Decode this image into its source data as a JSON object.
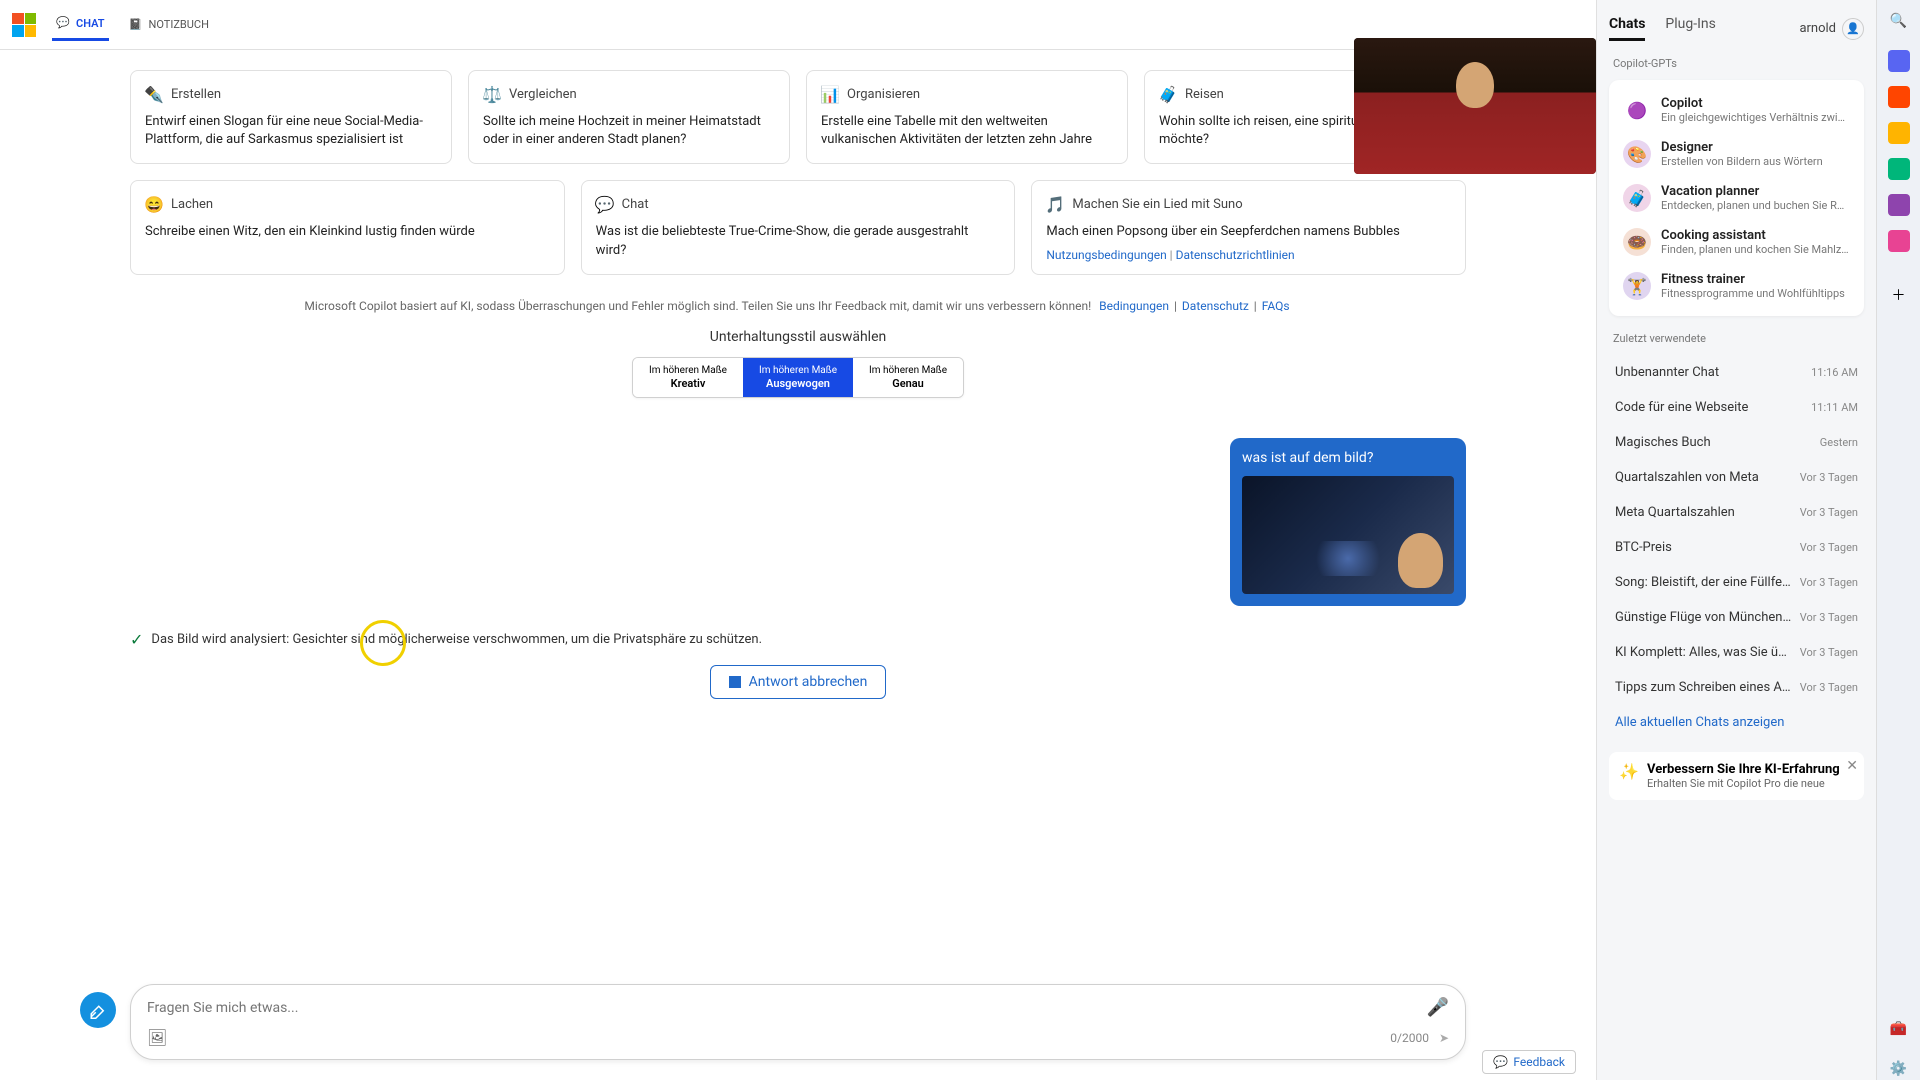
{
  "header": {
    "tab_chat": "CHAT",
    "tab_notebook": "NOTIZBUCH"
  },
  "cards_row1": [
    {
      "icon": "✒️",
      "title": "Erstellen",
      "body": "Entwirf einen Slogan für eine neue Social-Media-Plattform, die auf Sarkasmus spezialisiert ist"
    },
    {
      "icon": "⚖️",
      "title": "Vergleichen",
      "body": "Sollte ich meine Hochzeit in meiner Heimatstadt oder in einer anderen Stadt planen?"
    },
    {
      "icon": "📊",
      "title": "Organisieren",
      "body": "Erstelle eine Tabelle mit den weltweiten vulkanischen Aktivitäten der letzten zehn Jahre"
    },
    {
      "icon": "🧳",
      "title": "Reisen",
      "body": "Wohin sollte ich reisen, eine spirituelle Erfahrung möchte?"
    }
  ],
  "cards_row2": [
    {
      "icon": "😄",
      "title": "Lachen",
      "body": "Schreibe einen Witz, den ein Kleinkind lustig finden würde"
    },
    {
      "icon": "💬",
      "title": "Chat",
      "body": "Was ist die beliebteste True-Crime-Show, die gerade ausgestrahlt wird?"
    },
    {
      "icon": "🎵",
      "title": "Machen Sie ein Lied mit Suno",
      "body": "Mach einen Popsong über ein Seepferdchen namens Bubbles"
    }
  ],
  "legal_small": {
    "terms": "Nutzungsbedingungen",
    "privacy": "Datenschutzrichtlinien"
  },
  "disclaimer": {
    "text": "Microsoft Copilot basiert auf KI, sodass Überraschungen und Fehler möglich sind. Teilen Sie uns Ihr Feedback mit, damit wir uns verbessern können!",
    "link1": "Bedingungen",
    "link2": "Datenschutz",
    "link3": "FAQs"
  },
  "style_title": "Unterhaltungsstil auswählen",
  "style_prefix": "Im höheren Maße",
  "styles": [
    "Kreativ",
    "Ausgewogen",
    "Genau"
  ],
  "user_msg": "was ist auf dem bild?",
  "status_text": "Das Bild wird analysiert: Gesichter sind möglicherweise verschwommen, um die Privatsphäre zu schützen.",
  "cancel_label": "Antwort abbrechen",
  "composer": {
    "placeholder": "Fragen Sie mich etwas...",
    "counter": "0/2000"
  },
  "sidebar": {
    "tab_chats": "Chats",
    "tab_plugins": "Plug-Ins",
    "username": "arnold",
    "gpts_title": "Copilot-GPTs",
    "gpts": [
      {
        "icon": "🟣",
        "bg": "#fff",
        "name": "Copilot",
        "desc": "Ein gleichgewichtiges Verhältnis zwischen KI u"
      },
      {
        "icon": "🎨",
        "bg": "#e8d5f0",
        "name": "Designer",
        "desc": "Erstellen von Bildern aus Wörtern"
      },
      {
        "icon": "🧳",
        "bg": "#f0d5e8",
        "name": "Vacation planner",
        "desc": "Entdecken, planen und buchen Sie Reisen"
      },
      {
        "icon": "🍩",
        "bg": "#f5e0d5",
        "name": "Cooking assistant",
        "desc": "Finden, planen und kochen Sie Mahlzeiten"
      },
      {
        "icon": "🏋️",
        "bg": "#e0d5f0",
        "name": "Fitness trainer",
        "desc": "Fitnessprogramme und Wohlfühltipps"
      }
    ],
    "recent_title": "Zuletzt verwendete",
    "recents": [
      {
        "title": "Unbenannter Chat",
        "time": "11:16 AM"
      },
      {
        "title": "Code für eine Webseite",
        "time": "11:11 AM"
      },
      {
        "title": "Magisches Buch",
        "time": "Gestern"
      },
      {
        "title": "Quartalszahlen von Meta",
        "time": "Vor 3 Tagen"
      },
      {
        "title": "Meta Quartalszahlen",
        "time": "Vor 3 Tagen"
      },
      {
        "title": "BTC-Preis",
        "time": "Vor 3 Tagen"
      },
      {
        "title": "Song: Bleistift, der eine Füllfeder sein m",
        "time": "Vor 3 Tagen"
      },
      {
        "title": "Günstige Flüge von München nach Fra",
        "time": "Vor 3 Tagen"
      },
      {
        "title": "KI Komplett: Alles, was Sie über LLMs",
        "time": "Vor 3 Tagen"
      },
      {
        "title": "Tipps zum Schreiben eines Artikels üb",
        "time": "Vor 3 Tagen"
      }
    ],
    "show_all": "Alle aktuellen Chats anzeigen",
    "promo_title": "Verbessern Sie Ihre KI-Erfahrung",
    "promo_desc": "Erhalten Sie mit Copilot Pro die neue"
  },
  "feedback_label": "Feedback",
  "rail_colors": [
    "#5865f2",
    "#ff4500",
    "#ffb400",
    "#00b67a",
    "#8e44ad",
    "#e84393"
  ]
}
